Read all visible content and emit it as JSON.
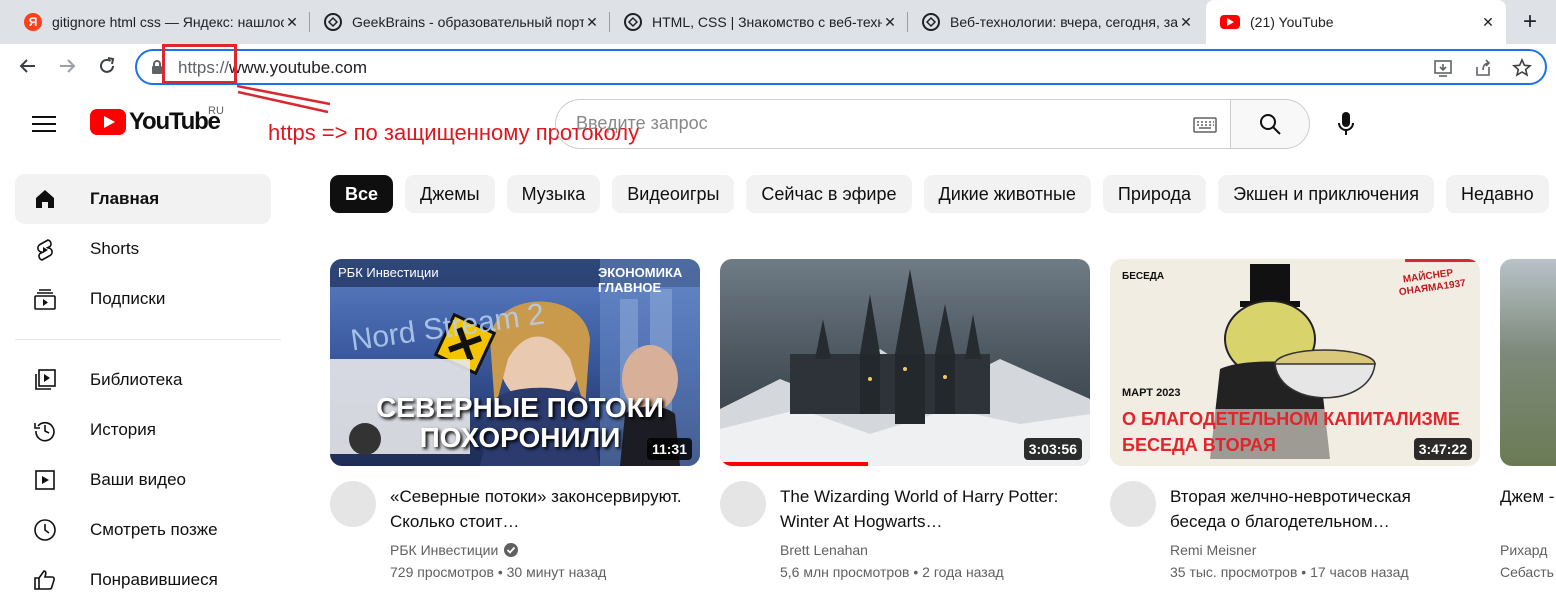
{
  "browser": {
    "tabs": [
      {
        "title": "gitignore html css — Яндекс: нашлось",
        "favicon": "yandex-icon",
        "favicon_color": "#fc3f1d"
      },
      {
        "title": "GeekBrains - образовательный портал",
        "favicon": "geekbrains-icon",
        "favicon_color": "#202124"
      },
      {
        "title": "HTML, CSS | Знакомство с веб-технологиями",
        "favicon": "geekbrains-icon",
        "favicon_color": "#202124"
      },
      {
        "title": "Веб-технологии: вчера, сегодня, завтра",
        "favicon": "geekbrains-icon",
        "favicon_color": "#202124"
      },
      {
        "title": "(21) YouTube",
        "favicon": "youtube-icon",
        "favicon_color": "#ff0000"
      }
    ],
    "close_glyph": "✕",
    "new_tab_glyph": "+",
    "address": {
      "scheme": "https://",
      "host": "www.youtube.com"
    }
  },
  "annotation": {
    "text": "https => по защищенному протоколу",
    "color": "#e0161f"
  },
  "youtube": {
    "logo_text": "YouTube",
    "country_code": "RU",
    "search_placeholder": "Введите запрос",
    "sidebar": [
      {
        "label": "Главная",
        "icon": "home-icon",
        "active": true
      },
      {
        "label": "Shorts",
        "icon": "shorts-icon"
      },
      {
        "label": "Подписки",
        "icon": "subscriptions-icon"
      },
      {
        "label": "Библиотека",
        "icon": "library-icon"
      },
      {
        "label": "История",
        "icon": "history-icon"
      },
      {
        "label": "Ваши видео",
        "icon": "your-videos-icon"
      },
      {
        "label": "Смотреть позже",
        "icon": "watch-later-icon"
      },
      {
        "label": "Понравившиеся",
        "icon": "liked-icon"
      }
    ],
    "chips": [
      "Все",
      "Джемы",
      "Музыка",
      "Видеоигры",
      "Сейчас в эфире",
      "Дикие животные",
      "Природа",
      "Экшен и приключения",
      "Недавно"
    ],
    "videos": [
      {
        "title": "«Северные потоки» законсервируют. Сколько стоит…",
        "channel": "РБК Инвестиции",
        "verified": true,
        "views": "729 просмотров",
        "age": "30 минут назад",
        "duration": "11:31",
        "thumb_text": {
          "top_left": "РБК Инвестиции",
          "top_right": "ЭКОНОМИКА ГЛАВНОЕ",
          "banner": "Nord Stream 2",
          "headline": "СЕВЕРНЫЕ ПОТОКИ ПОХОРОНИЛИ"
        }
      },
      {
        "title": "The Wizarding World of Harry Potter: Winter At Hogwarts…",
        "channel": "Brett Lenahan",
        "verified": false,
        "views": "5,6 млн просмотров",
        "age": "2 года назад",
        "duration": "3:03:56",
        "watched_fraction": 0.4
      },
      {
        "title": "Вторая желчно-невротическая беседа о благодетельном…",
        "channel": "Remi Meisner",
        "verified": false,
        "views": "35 тыс. просмотров",
        "age": "17 часов назад",
        "duration": "3:47:22",
        "thumb_text": {
          "top_left": "БЕСЕДА",
          "top_right": "МАЙСНЕР ОНАЯМА1937",
          "date": "МАРТ 2023",
          "headline": "О БЛАГОДЕТЕЛЬНОМ КАПИТАЛИЗМЕ",
          "sub": "БЕСЕДА ВТОРАЯ"
        }
      },
      {
        "title": "Джем - (Fingal'",
        "channel": "Рихард",
        "meta_partial": "Себасть"
      }
    ]
  }
}
